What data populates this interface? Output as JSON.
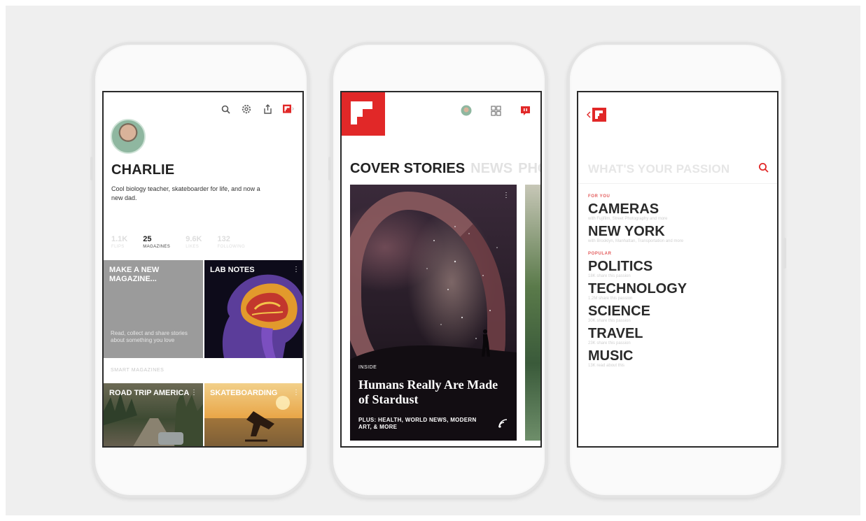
{
  "colors": {
    "brand_red": "#e12828",
    "background": "#efefef",
    "text_dark": "#222222",
    "text_faint": "#dcdcdc"
  },
  "profile": {
    "icons": [
      "search-icon",
      "gear-icon",
      "share-icon",
      "flipboard-logo-icon"
    ],
    "name": "CHARLIE",
    "bio": "Cool biology teacher, skateboarder for life, and now a new dad.",
    "stats": [
      {
        "value": "1.1K",
        "label": "FLIPS"
      },
      {
        "value": "25",
        "label": "MAGAZINES"
      },
      {
        "value": "9.6K",
        "label": "LIKES"
      },
      {
        "value": "132",
        "label": "FOLLOWING"
      }
    ],
    "make_tile": {
      "title": "MAKE A NEW MAGAZINE...",
      "desc": "Read, collect and share stories about something you love"
    },
    "lab_tile": {
      "title": "LAB NOTES"
    },
    "smart_label": "SMART MAGAZINES",
    "road_tile": {
      "title": "ROAD TRIP AMERICA"
    },
    "skate_tile": {
      "title": "SKATEBOARDING"
    }
  },
  "cover": {
    "tabs": [
      "COVER STORIES",
      "NEWS",
      "PHOTO"
    ],
    "card": {
      "kicker": "INSIDE",
      "headline": "Humans Really Are Made of Stardust",
      "plus": "PLUS: HEALTH, WORLD NEWS, MODERN ART, & MORE"
    }
  },
  "passion": {
    "title": "WHAT'S YOUR PASSION",
    "sections": [
      {
        "label": "FOR YOU",
        "items": [
          {
            "name": "CAMERAS",
            "sub": "with Fujifilm, Street Photography and more"
          },
          {
            "name": "NEW YORK",
            "sub": "with Brooklyn, Manhattan, Transportation and more"
          }
        ]
      },
      {
        "label": "POPULAR",
        "items": [
          {
            "name": "POLITICS",
            "sub": "18K share this passion"
          },
          {
            "name": "TECHNOLOGY",
            "sub": "1.2M share this passion"
          },
          {
            "name": "SCIENCE",
            "sub": "30K share this passion"
          },
          {
            "name": "TRAVEL",
            "sub": "23K share this passion"
          },
          {
            "name": "MUSIC",
            "sub": "13K read about this"
          }
        ]
      }
    ]
  }
}
